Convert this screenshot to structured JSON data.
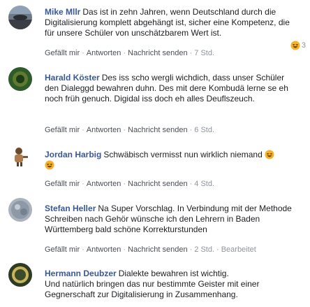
{
  "comments": [
    {
      "author": "Mike Mllr",
      "text": "Das ist in zehn Jahren, wenn Deutschland durch die Digitalisierung komplett abgehängt ist, sicher eine Kompetenz, die für unsere Schüler von unschätzbarem Wert ist.",
      "like": "Gefällt mir",
      "reply": "Antworten",
      "message": "Nachricht senden",
      "time": "7 Std.",
      "reaction_count": "3"
    },
    {
      "author": "Harald Köster",
      "text": "Des iss scho wergli wichdich, dass unser Schüler den Dialeggd bewahren duhn. Des mit dere Kombudä lerne se eh noch früh genuch. Digidal iss doch eh alles Deufl­szeuch.",
      "like": "Gefällt mir",
      "reply": "Antworten",
      "message": "Nachricht senden",
      "time": "6 Std."
    },
    {
      "author": "Jordan Harbig",
      "text": "Schwäbisch vermisst nun wirklich niemand",
      "like": "Gefällt mir",
      "reply": "Antworten",
      "message": "Nachricht senden",
      "time": "4 Std."
    },
    {
      "author": "Stefan Heller",
      "text": "Na Super Vorschlag. In Verbindung mit der Methode Schreiben nach Gehör wünsche ich den Lehrern in Baden Württemberg bald schöne Korrekturstunden",
      "like": "Gefällt mir",
      "reply": "Antworten",
      "message": "Nachricht senden",
      "time": "2 Std.",
      "edited": "Bearbeitet"
    },
    {
      "author": "Hermann Deubzer",
      "text": "Dialekte bewahren ist wichtig.",
      "text2": "Und natürlich bringen das nur bestimmte Geister mit einer Gegnerschaft zur Digitalisierung in Zusammenhang."
    }
  ],
  "colors": {
    "author": "#385898",
    "meta": "#90949c",
    "link": "#4b4f56"
  },
  "icons": [
    "laughing-emoji-icon"
  ]
}
